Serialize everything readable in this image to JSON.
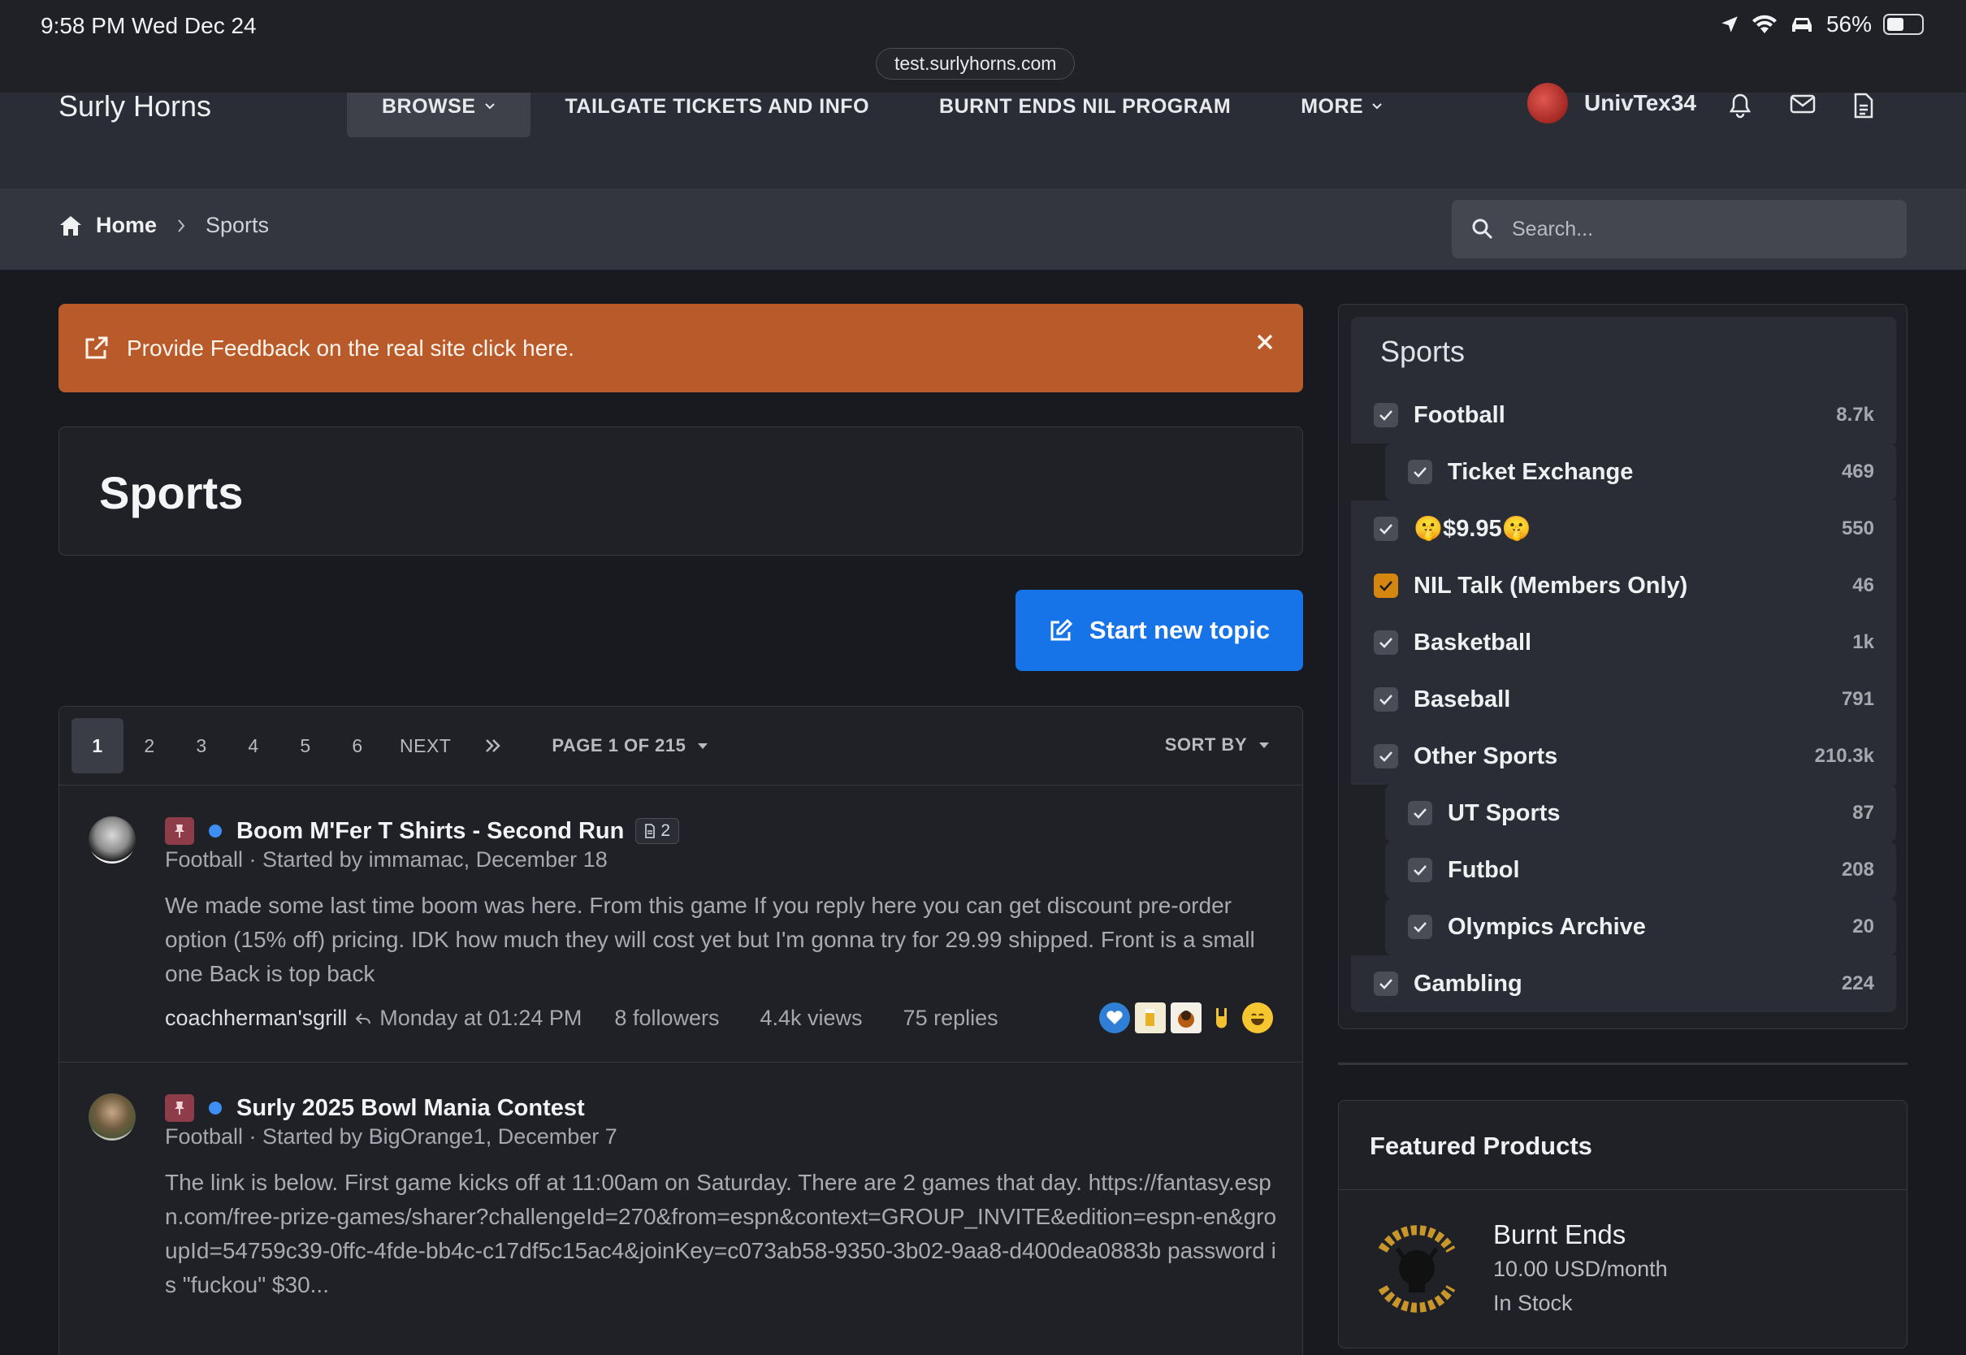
{
  "status": {
    "time": "9:58 PM  Wed Dec 24",
    "battery": "56%",
    "url": "test.surlyhorns.com"
  },
  "nav": {
    "brand": "Surly Horns",
    "items": [
      {
        "label": "BROWSE",
        "dropdown": true
      },
      {
        "label": "TAILGATE TICKETS AND INFO"
      },
      {
        "label": "BURNT ENDS NIL PROGRAM"
      },
      {
        "label": "MORE",
        "dropdown": true
      }
    ],
    "username": "UnivTex34"
  },
  "breadcrumb": {
    "home": "Home",
    "current": "Sports"
  },
  "search": {
    "placeholder": "Search..."
  },
  "feedback": {
    "text": "Provide Feedback on the real site click here."
  },
  "page": {
    "title": "Sports",
    "start_topic": "Start new topic"
  },
  "pager": {
    "pages": [
      "1",
      "2",
      "3",
      "4",
      "5",
      "6"
    ],
    "next": "NEXT",
    "page_of": "PAGE 1 OF 215",
    "sort_by": "SORT BY"
  },
  "topics": [
    {
      "title": "Boom M'Fer T Shirts - Second Run",
      "attachments": "2",
      "meta": "Football · Started by immamac, December 18",
      "body": "We made some last time boom was here. From this game If you reply here you can get discount pre-order option (15% off) pricing. IDK how much they will cost yet but I'm gonna try for 29.99 shipped. Front is a small one Back is top back",
      "last_user": "coachherman'sgrill",
      "last_time": "Monday at 01:24 PM",
      "followers": "8 followers",
      "views": "4.4k views",
      "replies": "75 replies"
    },
    {
      "title": "Surly 2025 Bowl Mania Contest",
      "meta": "Football · Started by BigOrange1, December 7",
      "body": "The link is below. First game kicks off at 11:00am on Saturday. There are 2 games that day. https://fantasy.espn.com/free-prize-games/sharer?challengeId=270&from=espn&context=GROUP_INVITE&edition=espn-en&groupId=54759c39-0ffc-4fde-bb4c-c17df5c15ac4&joinKey=c073ab58-9350-3b02-9aa8-d400dea0883b password is \"fuckou\" $30..."
    }
  ],
  "sidebar": {
    "title": "Sports",
    "categories": [
      {
        "label": "Football",
        "count": "8.7k"
      },
      {
        "label": "Ticket Exchange",
        "count": "469"
      },
      {
        "label": "🤫$9.95🤫",
        "count": "550"
      },
      {
        "label": "NIL Talk (Members Only)",
        "count": "46"
      },
      {
        "label": "Basketball",
        "count": "1k"
      },
      {
        "label": "Baseball",
        "count": "791"
      },
      {
        "label": "Other Sports",
        "count": "210.3k"
      },
      {
        "label": "UT Sports",
        "count": "87"
      },
      {
        "label": "Futbol",
        "count": "208"
      },
      {
        "label": "Olympics Archive",
        "count": "20"
      },
      {
        "label": "Gambling",
        "count": "224"
      }
    ]
  },
  "featured": {
    "title": "Featured Products",
    "product_name": "Burnt Ends",
    "price": "10.00 USD/month",
    "stock": "In Stock"
  }
}
